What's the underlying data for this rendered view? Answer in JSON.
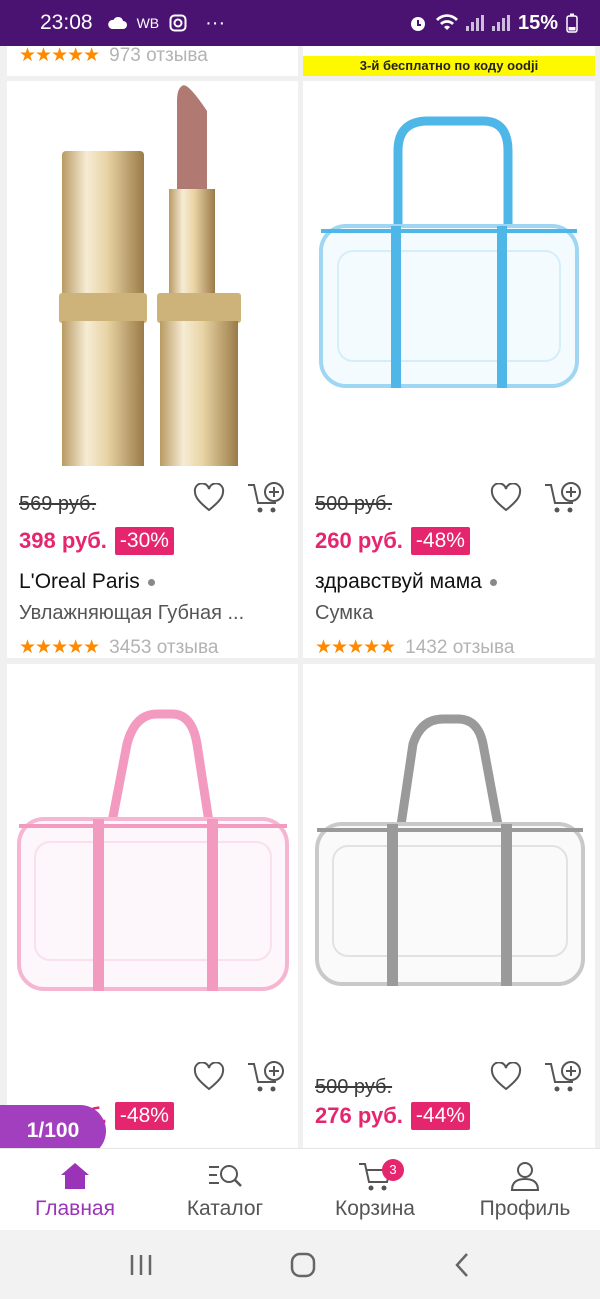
{
  "status_bar": {
    "time": "23:08",
    "carrier": "WB",
    "battery": "15%"
  },
  "top_partial": {
    "left_reviews": "973 отзыва",
    "promo_text": "3-й бесплатно по коду oodji"
  },
  "products": [
    {
      "old_price": "569 руб.",
      "new_price": "398 руб.",
      "discount": "-30%",
      "brand": "L'Oreal Paris",
      "name": "Увлажняющая Губная ...",
      "stars": "★★★★★",
      "reviews": "3453 отзыва"
    },
    {
      "old_price": "500 руб.",
      "new_price": "260 руб.",
      "discount": "-48%",
      "brand": "здравствуй мама",
      "name": "Сумка",
      "stars": "★★★★★",
      "reviews": "1432 отзыва"
    },
    {
      "old_price": "",
      "new_price": "260 руб.",
      "discount": "-48%"
    },
    {
      "old_price": "500 руб.",
      "new_price": "276 руб.",
      "discount": "-44%"
    }
  ],
  "counter": "1/100",
  "bottom_nav": {
    "items": [
      {
        "label": "Главная",
        "icon": "home-icon"
      },
      {
        "label": "Каталог",
        "icon": "catalog-search-icon"
      },
      {
        "label": "Корзина",
        "icon": "cart-icon"
      },
      {
        "label": "Профиль",
        "icon": "profile-icon"
      }
    ],
    "cart_badge": "3"
  },
  "colors": {
    "accent": "#9a33b8",
    "price": "#e5256e",
    "status_bar": "#4a1372",
    "stars": "#ff8a00"
  }
}
